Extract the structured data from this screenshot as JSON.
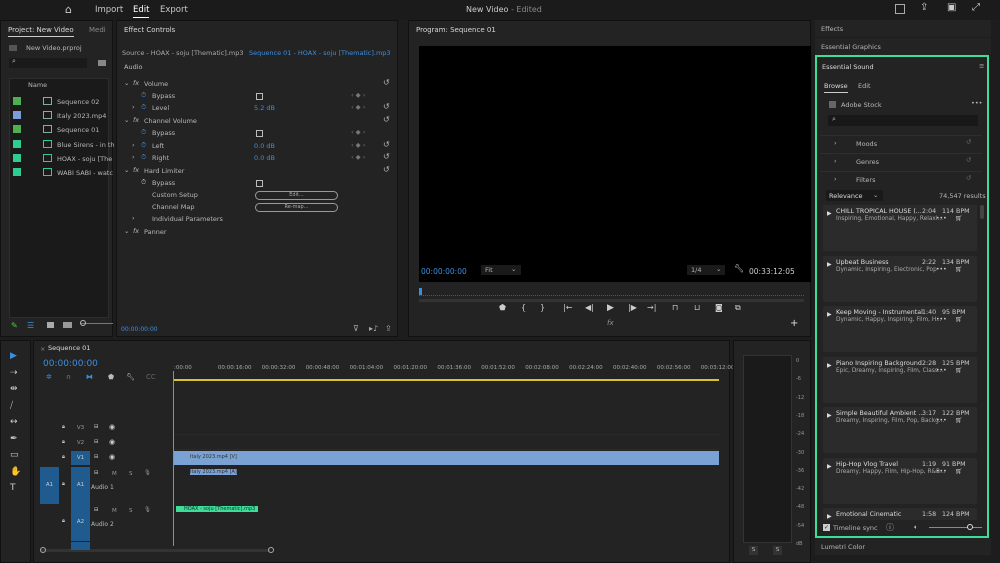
{
  "app": {
    "title": "New Video",
    "title_suffix": "- Edited",
    "nav": [
      "Import",
      "Edit",
      "Export"
    ],
    "active_nav": "Edit"
  },
  "project": {
    "tab": "Project: New Video",
    "tab2": "Medi",
    "file": "New Video.prproj",
    "search_placeholder": "",
    "col_name": "Name",
    "items": [
      {
        "name": "Sequence 02",
        "color": "#4caf50",
        "type": "sequence"
      },
      {
        "name": "Italy 2023.mp4",
        "color": "#7a9fd8",
        "type": "video"
      },
      {
        "name": "Sequence 01",
        "color": "#4caf50",
        "type": "sequence"
      },
      {
        "name": "Blue Sirens - in th",
        "color": "#2ecc8f",
        "type": "audio"
      },
      {
        "name": "HOAX - soju [The",
        "color": "#2ecc8f",
        "type": "audio"
      },
      {
        "name": "WABI SABI - watc",
        "color": "#2ecc8f",
        "type": "audio"
      }
    ]
  },
  "effect_controls": {
    "tab": "Effect Controls",
    "source": "Source - HOAX - soju [Thematic].mp3",
    "sequence": "Sequence 01 - HOAX - soju [Thematic].mp3",
    "section": "Audio",
    "rows": [
      {
        "label": "Volume",
        "kind": "fx"
      },
      {
        "label": "Bypass",
        "kind": "check"
      },
      {
        "label": "Level",
        "kind": "value",
        "value": "5.2 dB"
      },
      {
        "label": "Channel Volume",
        "kind": "fx"
      },
      {
        "label": "Bypass",
        "kind": "check"
      },
      {
        "label": "Left",
        "kind": "value",
        "value": "0.0 dB"
      },
      {
        "label": "Right",
        "kind": "value",
        "value": "0.0 dB"
      },
      {
        "label": "Hard Limiter",
        "kind": "fx"
      },
      {
        "label": "Bypass",
        "kind": "check"
      },
      {
        "label": "Custom Setup",
        "kind": "button",
        "value": "Edit..."
      },
      {
        "label": "Channel Map",
        "kind": "button",
        "value": "Re-map..."
      },
      {
        "label": "Individual Parameters",
        "kind": "sub"
      },
      {
        "label": "Panner",
        "kind": "fx"
      }
    ],
    "timecode": "00:00:00:00"
  },
  "program": {
    "tab": "Program: Sequence 01",
    "timecode": "00:00:00:00",
    "fit": "Fit",
    "resolution": "1/4",
    "duration": "00:33:12:05"
  },
  "right_panel": {
    "effects": "Effects",
    "essential_graphics": "Essential Graphics",
    "essential_sound": "Essential Sound",
    "tabs": [
      "Browse",
      "Edit"
    ],
    "stock": "Adobe Stock",
    "filters": [
      "Moods",
      "Genres",
      "Filters"
    ],
    "sort": "Relevance",
    "results": "74,547 results",
    "timeline_sync": "Timeline sync",
    "lumetri": "Lumetri Color",
    "accent": "#3ddc97",
    "tracks": [
      {
        "title": "CHILL TROPICAL HOUSE (...",
        "dur": "2:04",
        "bpm": "114 BPM",
        "tags": "Inspiring, Emotional, Happy, Relaxi..."
      },
      {
        "title": "Upbeat Business",
        "dur": "2:22",
        "bpm": "134 BPM",
        "tags": "Dynamic, Inspiring, Electronic, Pop"
      },
      {
        "title": "Keep Moving - Instrumental",
        "dur": "1:40",
        "bpm": "95 BPM",
        "tags": "Dynamic, Happy, Inspiring, Film, H..."
      },
      {
        "title": "Piano Inspiring Background",
        "dur": "2:28",
        "bpm": "125 BPM",
        "tags": "Epic, Dreamy, Inspiring, Film, Class..."
      },
      {
        "title": "Simple Beautiful Ambient ...",
        "dur": "3:17",
        "bpm": "122 BPM",
        "tags": "Dreamy, Inspiring, Film, Pop, Backg..."
      },
      {
        "title": "Hip-Hop Vlog Travel",
        "dur": "1:19",
        "bpm": "91 BPM",
        "tags": "Dreamy, Happy, Film, Hip-Hop, R&B..."
      },
      {
        "title": "Emotional Cinematic",
        "dur": "1:58",
        "bpm": "124 BPM",
        "tags": ""
      }
    ]
  },
  "timeline": {
    "tab": "Sequence 01",
    "timecode": "00:00:00:00",
    "ruler": [
      ":00:00",
      "00:00:16:00",
      "00:00:32:00",
      "00:00:48:00",
      "00:01:04:00",
      "00:01:20:00",
      "00:01:36:00",
      "00:01:52:00",
      "00:02:08:00",
      "00:02:24:00",
      "00:02:40:00",
      "00:02:56:00",
      "00:03:12:00"
    ],
    "video_tracks": [
      "V3",
      "V2",
      "V1"
    ],
    "audio_tracks": [
      {
        "id": "A1",
        "name": "Audio 1"
      },
      {
        "id": "A2",
        "name": "Audio 2"
      }
    ],
    "source_patch": "A1",
    "clips": {
      "v1": "Italy 2023.mp4 [V]",
      "a1": "Italy 2023.mp4 [A]",
      "a2": "HOAX - soju [Thematic].mp3"
    },
    "meter_scale": [
      "0",
      "-6",
      "-12",
      "-18",
      "-24",
      "-30",
      "-36",
      "-42",
      "-48",
      "-54",
      "dB"
    ],
    "solo": [
      "S",
      "S"
    ],
    "track_btns": {
      "m": "M",
      "s": "S"
    }
  }
}
